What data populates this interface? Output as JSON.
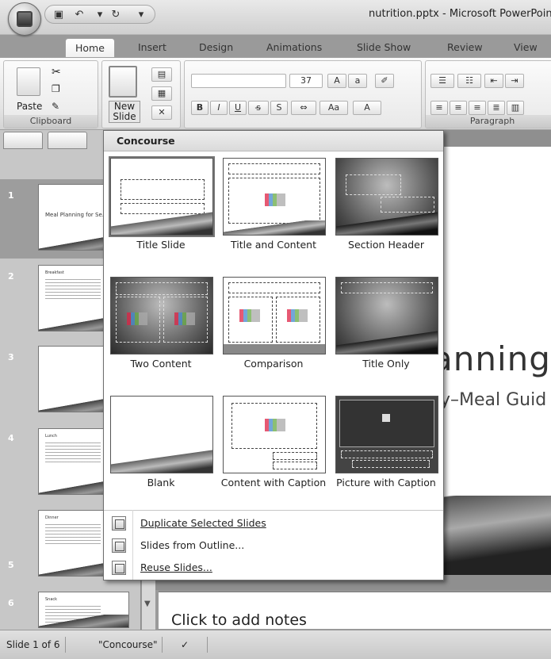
{
  "window": {
    "title": "nutrition.pptx - Microsoft PowerPoint"
  },
  "colors": {
    "ribbon_bg": "#e4e4e4",
    "accent_dark": "#333333",
    "selection_outline": "#777777"
  },
  "ribbon": {
    "tabs": [
      "Home",
      "Insert",
      "Design",
      "Animations",
      "Slide Show",
      "Review",
      "View"
    ],
    "active_tab": "Home",
    "clipboard": {
      "paste_label": "Paste",
      "group_label": "Clipboard"
    },
    "slides": {
      "new_slide_label": "New Slide"
    },
    "font": {
      "font_name": "",
      "font_size": "37"
    },
    "paragraph": {
      "group_label": "Paragraph"
    }
  },
  "slide_pane": {
    "slides": [
      {
        "number": "1",
        "title": "Meal Planning for Se..."
      },
      {
        "number": "2",
        "title": "Breakfast"
      },
      {
        "number": "3",
        "title": ""
      },
      {
        "number": "4",
        "title": "Lunch"
      },
      {
        "number": "5",
        "title": "Dinner"
      },
      {
        "number": "6",
        "title": "Snack"
      }
    ]
  },
  "slide": {
    "title_partial": "anning",
    "subtitle_partial": "y–Meal Guid"
  },
  "notes": {
    "placeholder": "Click to add notes"
  },
  "status_bar": {
    "slide_position": "Slide 1 of 6",
    "theme": "\"Concourse\""
  },
  "new_slide_menu": {
    "header": "Concourse",
    "layouts": [
      {
        "name": "Title Slide"
      },
      {
        "name": "Title and Content"
      },
      {
        "name": "Section Header"
      },
      {
        "name": "Two Content"
      },
      {
        "name": "Comparison"
      },
      {
        "name": "Title Only"
      },
      {
        "name": "Blank"
      },
      {
        "name": "Content with Caption"
      },
      {
        "name": "Picture with Caption"
      }
    ],
    "actions": [
      {
        "label": "Duplicate Selected Slides"
      },
      {
        "label": "Slides from Outline..."
      },
      {
        "label": "Reuse Slides..."
      }
    ]
  }
}
